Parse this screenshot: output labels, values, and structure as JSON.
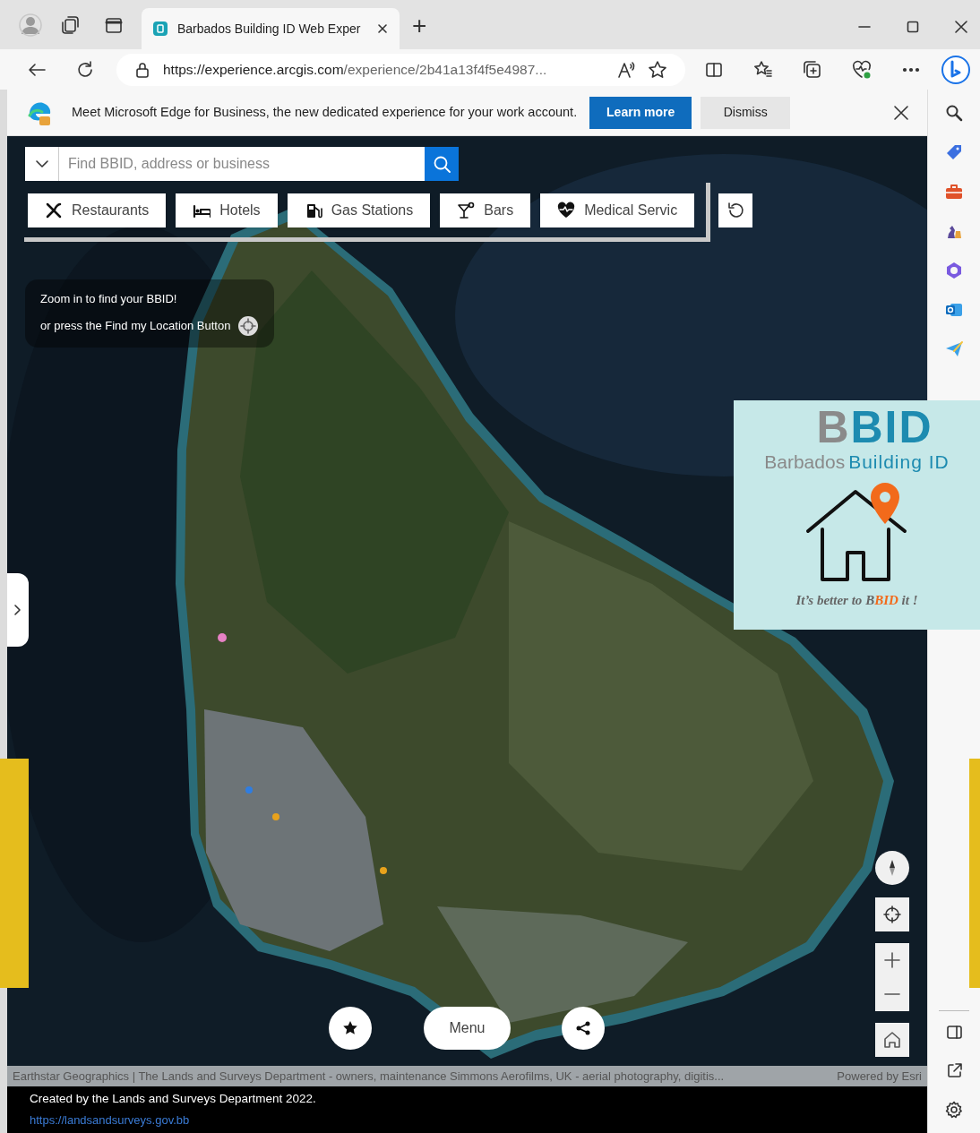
{
  "browser": {
    "tabs": [
      {
        "title": "Barbados Building ID Web Exper",
        "selected": true
      }
    ],
    "new_tab": "+",
    "url_host": "https://experience.arcgis.com",
    "url_path": "/experience/2b41a13f4f5e4987..."
  },
  "infobar": {
    "message": "Meet Microsoft Edge for Business, the new dedicated experience for your work account.",
    "primary_button": "Learn more",
    "secondary_button": "Dismiss"
  },
  "search": {
    "placeholder": "Find BBID, address or business"
  },
  "categories": [
    {
      "label": "Restaurants",
      "kind": "restaurant"
    },
    {
      "label": "Hotels",
      "kind": "hotel"
    },
    {
      "label": "Gas Stations",
      "kind": "gas"
    },
    {
      "label": "Bars",
      "kind": "bar"
    },
    {
      "label": "Medical Servic",
      "kind": "medical"
    }
  ],
  "hint": {
    "line_1": "Zoom in to find your BBID!",
    "line_2": "or press the Find my Location Button"
  },
  "logo": {
    "title": [
      "B",
      "BID"
    ],
    "subtitle": [
      "Barbados",
      "Building ID"
    ],
    "tagline": [
      "It’s better to ",
      "B",
      "BID",
      " it !"
    ]
  },
  "menu_button": "Menu",
  "attribution": {
    "sources": "Earthstar Geographics | The Lands and Surveys Department - owners, maintenance Simmons Aerofilms, UK - aerial photography, digitis...",
    "powered_by": "Powered by Esri"
  },
  "footer": {
    "text": "Created by the Lands and Surveys Department 2022.",
    "link": "https://landsandsurveys.gov.bb"
  }
}
